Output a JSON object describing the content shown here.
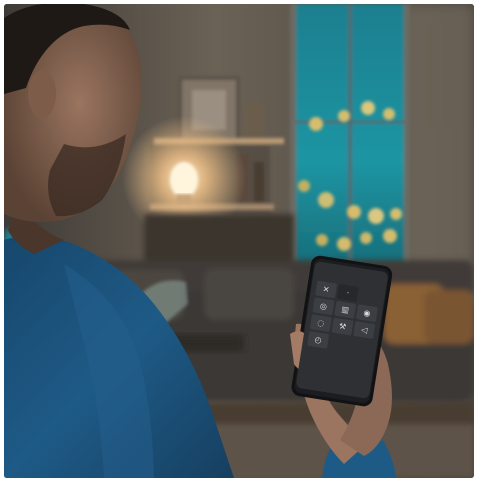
{
  "image": {
    "description_free": true
  },
  "phone": {
    "status_left": "",
    "status_right": "",
    "brand_text": "",
    "tiles": [
      {
        "icon": "fan-icon",
        "glyph": "✕"
      },
      {
        "icon": "dot-icon",
        "glyph": "·"
      },
      {
        "icon": "empty-icon",
        "glyph": ""
      },
      {
        "icon": "climate-icon",
        "glyph": "◎"
      },
      {
        "icon": "heater-icon",
        "glyph": "▥"
      },
      {
        "icon": "power-icon",
        "glyph": "◉"
      },
      {
        "icon": "scene-icon",
        "glyph": "◌"
      },
      {
        "icon": "tools-icon",
        "glyph": "⚒"
      },
      {
        "icon": "share-icon",
        "glyph": "◁"
      },
      {
        "icon": "timer-icon",
        "glyph": "◴"
      },
      {
        "icon": "empty-icon",
        "glyph": ""
      },
      {
        "icon": "empty-icon",
        "glyph": ""
      }
    ]
  },
  "colors": {
    "window_glow": "#1f8f9e",
    "lamp_glow": "#f2c38a",
    "shirt": "#1e5a86",
    "sofa": "#3a3734"
  }
}
